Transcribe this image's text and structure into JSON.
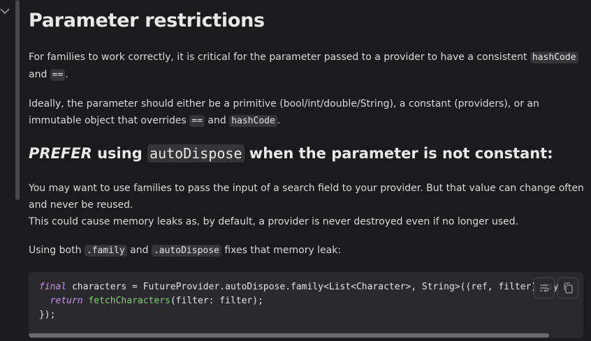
{
  "sidebar": {
    "collapse_icon": "chevron-down-icon"
  },
  "article": {
    "title": "Parameter restrictions",
    "para1": {
      "before": "For families to work correctly, it is critical for the parameter passed to a provider to have a consistent ",
      "code1": "hashCode",
      "middle": " and ",
      "code2": "==",
      "after": "."
    },
    "para2": {
      "before": "Ideally, the parameter should either be a primitive (bool/int/double/String), a constant (providers), or an immutable object that overrides ",
      "code1": "==",
      "middle": " and ",
      "code2": "hashCode",
      "after": "."
    },
    "heading2": {
      "emph": "PREFER",
      "before": " using ",
      "code": "autoDispose",
      "after": " when the parameter is not constant:"
    },
    "para3_line1": "You may want to use families to pass the input of a search field to your provider. But that value can change often and never be reused.",
    "para3_line2": "This could cause memory leaks as, by default, a provider is never destroyed even if no longer used.",
    "para4": {
      "before": "Using both ",
      "code1": ".family",
      "middle": " and ",
      "code2": ".autoDispose",
      "after": " fixes that memory leak:"
    }
  },
  "code_block": {
    "line1_kw": "final",
    "line1_rest": " characters = FutureProvider.autoDispose.family<List<Character>, String>((ref, filter) asy",
    "line2_indent": "  ",
    "line2_kw": "return",
    "line2_space": " ",
    "line2_fn": "fetchCharacters",
    "line2_rest": "(filter: filter);",
    "line3": "});",
    "wrap_button_icon": "word-wrap-icon",
    "copy_button_icon": "copy-icon"
  }
}
